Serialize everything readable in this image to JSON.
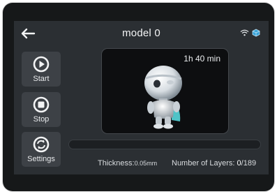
{
  "header": {
    "title": "model 0",
    "back_icon": "back-arrow-icon",
    "status_icons": [
      "wifi-icon",
      "cube-icon"
    ]
  },
  "sidebar": {
    "start_label": "Start",
    "stop_label": "Stop",
    "settings_label": "Settings"
  },
  "preview": {
    "time_left": "1h 40 min"
  },
  "progress": {
    "fraction": 0
  },
  "stats": {
    "thickness_label": "Thickness:",
    "thickness_value": "0.05mm",
    "layers_label": "Number of Layers:",
    "current_layer": "0",
    "total_layers": "/189"
  },
  "colors": {
    "accent": "#5aa7e0",
    "screen_bg": "#2b2f33",
    "button_bg": "#3d4146"
  }
}
